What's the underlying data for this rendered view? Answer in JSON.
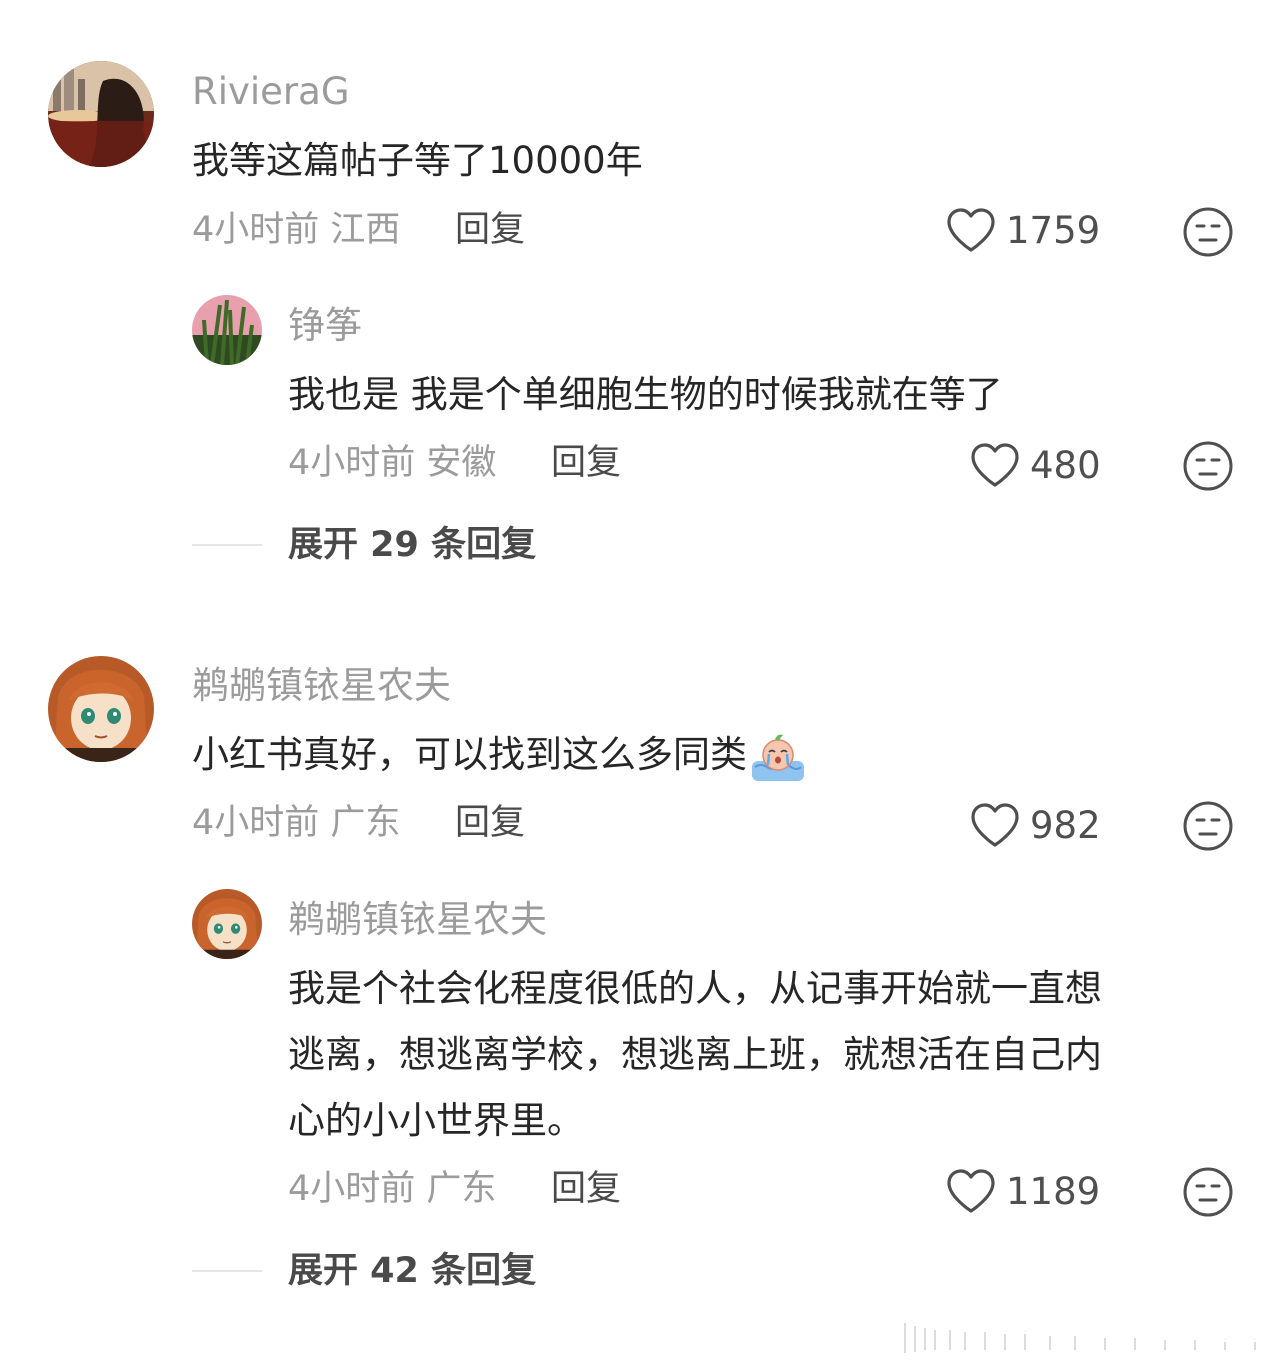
{
  "comments": [
    {
      "user": "RivieraG",
      "text": "我等这篇帖子等了10000年",
      "time": "4小时前",
      "location": "江西",
      "reply_label": "回复",
      "likes": "1759",
      "replies": [
        {
          "user": "铮筝",
          "text": "我也是 我是个单细胞生物的时候我就在等了",
          "time": "4小时前",
          "location": "安徽",
          "reply_label": "回复",
          "likes": "480"
        }
      ],
      "expand_label": "展开 29 条回复"
    },
    {
      "user": "鹈鹕镇铱星农夫",
      "text": "小红书真好，可以找到这么多同类",
      "time": "4小时前",
      "location": "广东",
      "reply_label": "回复",
      "likes": "982",
      "replies": [
        {
          "user": "鹈鹕镇铱星农夫",
          "text_lines": [
            "我是个社会化程度很低的人，从记事开始就一直想",
            "逃离，想逃离学校，想逃离上班，就想活在自己内",
            "心的小小世界里。"
          ],
          "time": "4小时前",
          "location": "广东",
          "reply_label": "回复",
          "likes": "1189"
        }
      ],
      "expand_label": "展开 42 条回复"
    }
  ],
  "icons": {
    "like": "heart-outline-icon",
    "emoji": "neutral-face-icon",
    "sticker": "crying-peach-sticker"
  },
  "colors": {
    "username": "#9b9b9b",
    "text": "#262626",
    "meta": "#9b9b9b",
    "action": "#4a4a4a"
  }
}
